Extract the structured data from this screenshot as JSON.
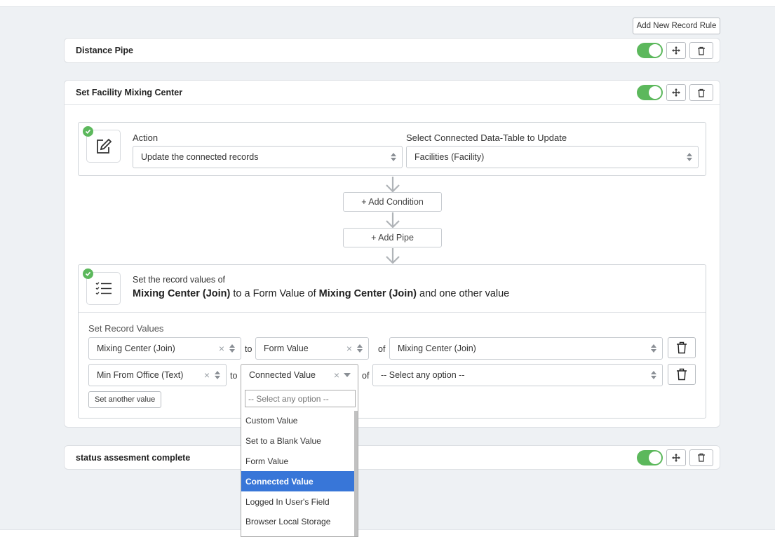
{
  "toolbar": {
    "add_rule_label": "Add New Record Rule"
  },
  "rules": [
    {
      "title": "Distance Pipe",
      "enabled": true
    },
    {
      "title": "Set Facility Mixing Center",
      "enabled": true
    },
    {
      "title": "status assesment complete",
      "enabled": true
    }
  ],
  "action_step": {
    "action_label": "Action",
    "action_value": "Update the connected records",
    "table_label": "Select Connected Data-Table to Update",
    "table_value": "Facilities (Facility)"
  },
  "flow": {
    "add_condition": "+ Add Condition",
    "add_pipe": "+ Add Pipe"
  },
  "summary": {
    "heading": "Set the record values of",
    "field": "Mixing Center (Join)",
    "middle": "to a Form Value of",
    "source": "Mixing Center (Join)",
    "tail": "and one other value"
  },
  "record_values": {
    "label": "Set Record Values",
    "rows": [
      {
        "target": "Mixing Center (Join)",
        "to": "to",
        "mode": "Form Value",
        "of": "of",
        "source": "Mixing Center (Join)"
      },
      {
        "target": "Min From Office (Text)",
        "to": "to",
        "mode": "Connected Value",
        "of": "of",
        "source": "-- Select any option --"
      }
    ],
    "add_label": "Set another value"
  },
  "dropdown": {
    "search_placeholder": "-- Select any option --",
    "options": [
      "Custom Value",
      "Set to a Blank Value",
      "Form Value",
      "Connected Value",
      "Logged In User's Field",
      "Browser Local Storage"
    ],
    "selected": "Connected Value"
  },
  "colors": {
    "accent": "#5cb85c",
    "highlight": "#3876d8"
  }
}
